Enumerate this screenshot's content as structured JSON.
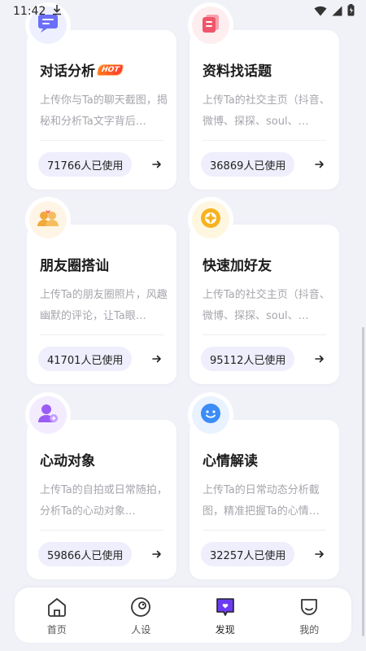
{
  "status_bar": {
    "time": "11:42"
  },
  "cards": [
    {
      "title": "对话分析",
      "badge": "HOT",
      "desc": "上传你与Ta的聊天截图，揭秘和分析Ta文字背后…",
      "usage": "71766人已使用",
      "icon": "chat-analysis-icon",
      "icon_color": "#6b6ef7"
    },
    {
      "title": "资料找话题",
      "desc": "上传Ta的社交主页（抖音、微博、探探、soul、…",
      "usage": "36869人已使用",
      "icon": "profile-topic-icon",
      "icon_color": "#f0556a"
    },
    {
      "title": "朋友圈搭讪",
      "desc": "上传Ta的朋友圈照片，风趣幽默的评论，让Ta眼…",
      "usage": "41701人已使用",
      "icon": "moments-flirt-icon",
      "icon_color": "#f2a93b"
    },
    {
      "title": "快速加好友",
      "desc": "上传Ta的社交主页（抖音、微博、探探、soul、…",
      "usage": "95112人已使用",
      "icon": "quick-add-friend-icon",
      "icon_color": "#f6b21f"
    },
    {
      "title": "心动对象",
      "desc": "上传Ta的自拍或日常随拍，分析Ta的心动对象…",
      "usage": "59866人已使用",
      "icon": "crush-icon",
      "icon_color": "#9a5cf5"
    },
    {
      "title": "心情解读",
      "desc": "上传Ta的日常动态分析截图，精准把握Ta的心情…",
      "usage": "32257人已使用",
      "icon": "mood-icon",
      "icon_color": "#3b8cf7"
    }
  ],
  "bottom_nav": [
    {
      "label": "首页",
      "icon": "home-icon"
    },
    {
      "label": "人设",
      "icon": "persona-icon"
    },
    {
      "label": "发现",
      "icon": "discover-icon",
      "active": true
    },
    {
      "label": "我的",
      "icon": "profile-icon"
    }
  ],
  "colors": {
    "background": "#f1f1f8",
    "pill": "#eeeefc",
    "accent": "#6b3bf2"
  }
}
